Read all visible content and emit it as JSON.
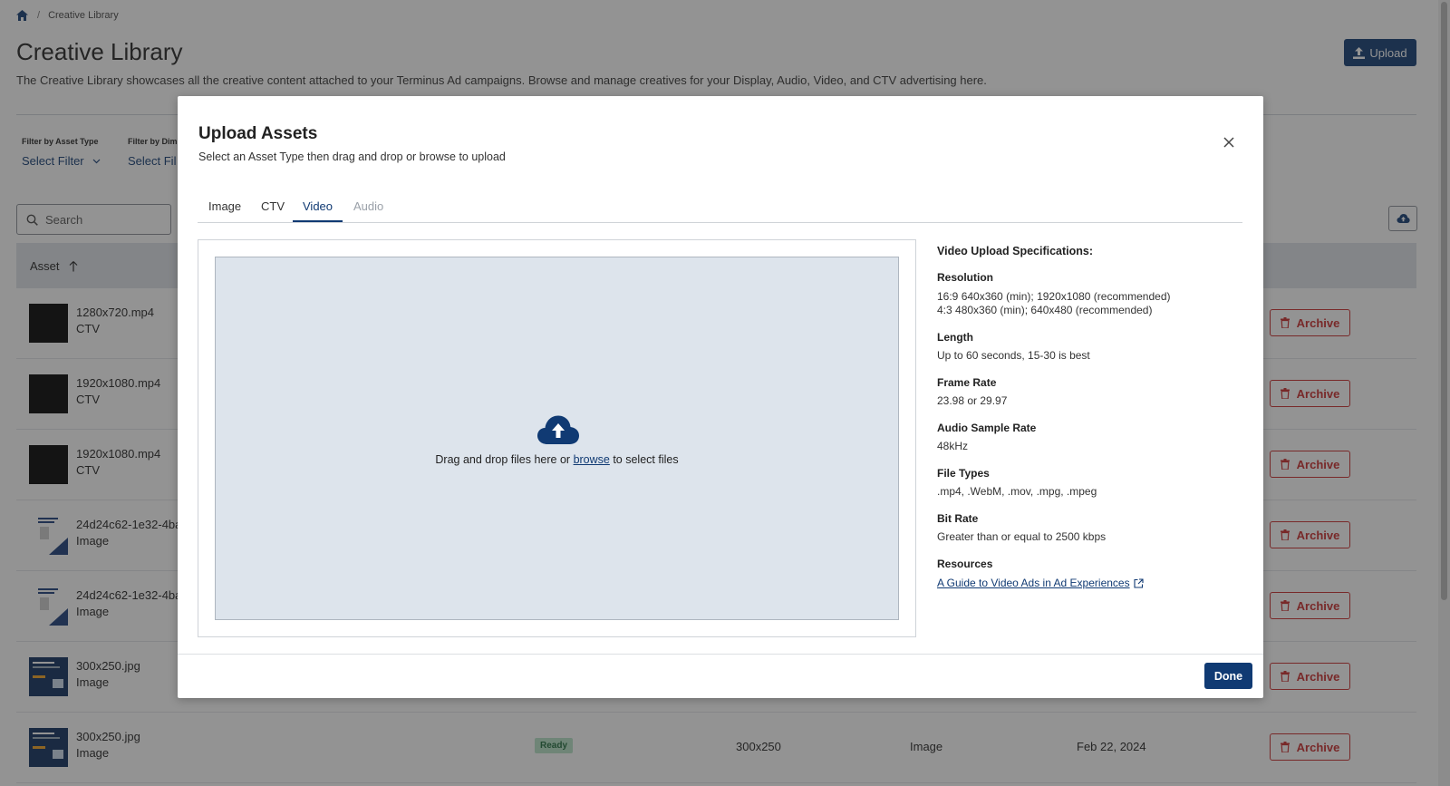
{
  "breadcrumb": {
    "current": "Creative Library",
    "separator": "/"
  },
  "page": {
    "title": "Creative Library",
    "description": "The Creative Library showcases all the creative content attached to your Terminus Ad campaigns. Browse and manage creatives for your Display, Audio, Video, and CTV advertising here.",
    "upload_label": "Upload"
  },
  "filters": {
    "asset_type": {
      "label": "Filter by Asset Type",
      "value": "Select Filter"
    },
    "dimension": {
      "label": "Filter by Dim",
      "value": "Select Fil"
    }
  },
  "search": {
    "placeholder": "Search"
  },
  "table": {
    "asset_header": "Asset",
    "archive_label": "Archive",
    "rows": [
      {
        "name": "1280x720.mp4",
        "type": "CTV"
      },
      {
        "name": "1920x1080.mp4",
        "type": "CTV"
      },
      {
        "name": "1920x1080.mp4",
        "type": "CTV"
      },
      {
        "name": "24d24c62-1e32-4ba",
        "type": "Image"
      },
      {
        "name": "24d24c62-1e32-4ba",
        "type": "Image"
      },
      {
        "name": "300x250.jpg",
        "type": "Image"
      },
      {
        "name": "300x250.jpg",
        "type": "Image",
        "status": "Ready",
        "dimensions": "300x250",
        "asset_type": "Image",
        "date": "Feb 22, 2024"
      }
    ]
  },
  "modal": {
    "title": "Upload Assets",
    "subtitle": "Select an Asset Type then drag and drop or browse to upload",
    "tabs": [
      "Image",
      "CTV",
      "Video",
      "Audio"
    ],
    "active_tab": "Video",
    "dropzone": {
      "text_before": "Drag and drop files here or ",
      "browse": "browse",
      "text_after": " to select files"
    },
    "specs": {
      "title": "Video Upload Specifications:",
      "resolution": {
        "heading": "Resolution",
        "line1": "16:9 640x360 (min); 1920x1080 (recommended)",
        "line2": "4:3 480x360 (min); 640x480 (recommended)"
      },
      "length": {
        "heading": "Length",
        "value": "Up to 60 seconds, 15-30 is best"
      },
      "frame_rate": {
        "heading": "Frame Rate",
        "value": "23.98 or 29.97"
      },
      "audio_sample_rate": {
        "heading": "Audio Sample Rate",
        "value": "48kHz"
      },
      "file_types": {
        "heading": "File Types",
        "value": ".mp4, .WebM, .mov, .mpg, .mpeg"
      },
      "bit_rate": {
        "heading": "Bit Rate",
        "value": "Greater than or equal to 2500 kbps"
      },
      "resources": {
        "heading": "Resources",
        "link": "A Guide to Video Ads in Ad Experiences"
      }
    },
    "done_label": "Done"
  },
  "colors": {
    "primary": "#103a73",
    "danger": "#c92a2a",
    "dropzone_bg": "#dde4ec",
    "ready_bg": "#b6e2c6"
  }
}
